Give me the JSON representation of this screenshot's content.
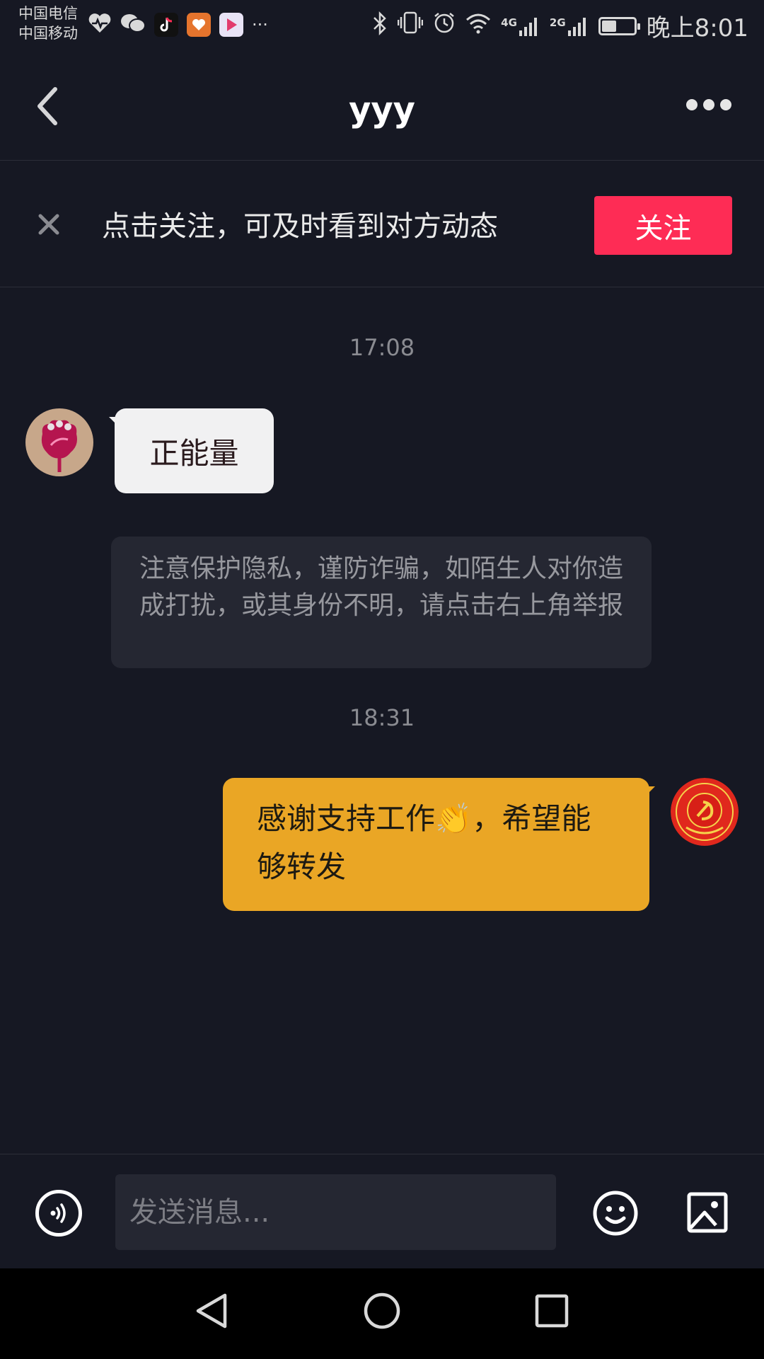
{
  "status_bar": {
    "carrier_1": "中国电信",
    "carrier_2": "中国移动",
    "more_icons": "···",
    "net_1": "4G",
    "net_2": "2G",
    "battery_level": 0.45,
    "time": "晚上8:01"
  },
  "header": {
    "title": "yyy",
    "back_icon": "chevron-left-icon",
    "more_icon": "more-horizontal-icon"
  },
  "follow_banner": {
    "close_icon": "close-icon",
    "text": "点击关注，可及时看到对方动态",
    "follow_label": "关注",
    "follow_color": "#fe2c55"
  },
  "chat": {
    "timestamp_1": "17:08",
    "incoming_message": "正能量",
    "privacy_notice": "注意保护隐私，谨防诈骗，如陌生人对你造成打扰，或其身份不明，请点击右上角举报",
    "timestamp_2": "18:31",
    "outgoing_message_part1": "感谢支持工作",
    "outgoing_emoji": "👏",
    "outgoing_message_part2": "，希望能够转发",
    "outgoing_color": "#eaa625"
  },
  "input_bar": {
    "placeholder": "发送消息...",
    "voice_icon": "voice-icon",
    "emoji_icon": "emoji-icon",
    "image_icon": "image-icon"
  },
  "nav_bar": {
    "back_icon": "nav-back-icon",
    "home_icon": "nav-home-icon",
    "recents_icon": "nav-recents-icon"
  }
}
